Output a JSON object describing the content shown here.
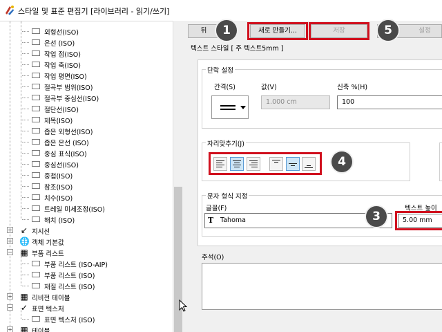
{
  "window": {
    "title": "스타일 및 표준 편집기 [라이브러리 - 읽기/쓰기]"
  },
  "tree": {
    "children_a": [
      "외형선(ISO)",
      "은선 (ISO)",
      "작업 점(ISO)",
      "작업 축(ISO)",
      "작업 평면(ISO)",
      "절곡부 범위(ISO)",
      "절곡부 중심선(ISO)",
      "절단선(ISO)",
      "제목(ISO)",
      "좁은 외형선(ISO)",
      "좁은 은선 (ISO)",
      "중심 표식(ISO)",
      "중심선(ISO)",
      "중첩(ISO)",
      "참조(ISO)",
      "치수(ISO)",
      "트레일 미세조정(ISO)",
      "해치 (ISO)"
    ],
    "node_leader": "지시선",
    "node_object_defaults": "객체 기본값",
    "node_parts_list": "부품 리스트",
    "children_parts": [
      "부품 리스트 (ISO-AIP)",
      "부품 리스트 (ISO)",
      "재질 리스트 (ISO)"
    ],
    "node_revision_table": "리비전 테이블",
    "node_surface_texture": "표면 텍스처",
    "children_surface": [
      "표면 텍스처 (ISO)"
    ],
    "node_table": "테이블"
  },
  "toolbar": {
    "back_label": "뒤",
    "new_label": "새로 만들기...",
    "save_label": "저장",
    "reset_label": "설정"
  },
  "style_header": "텍스트 스타일 [ 주 텍스트5mm ]",
  "paragraph": {
    "title": "단락 설정",
    "spacing_label": "간격(S)",
    "value_label": "값(V)",
    "value": "1.000 cm",
    "stretch_label": "신축 %(H)",
    "stretch_value": "100"
  },
  "justification": {
    "title": "자리맞추기(J)"
  },
  "char_format": {
    "title": "문자 형식 지정",
    "font_label": "글꼴(F)",
    "font_value": "Tahoma",
    "height_label": "텍스트 높이",
    "height_value": "5.00 mm"
  },
  "comments": {
    "label": "주석(O)"
  },
  "callouts": [
    "1",
    "3",
    "4",
    "5"
  ],
  "colors": {
    "highlight": "#d0101e",
    "badge": "#4a4a4a",
    "active_button": "#cde6f7"
  }
}
